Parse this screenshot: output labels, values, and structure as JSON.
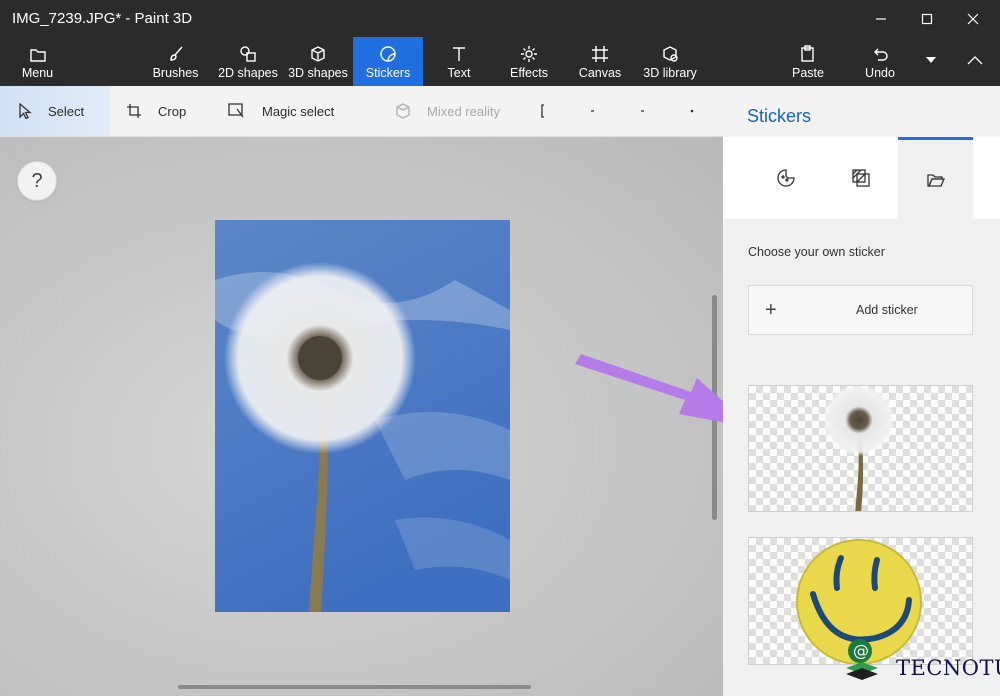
{
  "window": {
    "title": "IMG_7239.JPG* - Paint 3D",
    "controls": [
      "minimize",
      "maximize",
      "close"
    ]
  },
  "ribbon": {
    "menu_label": "Menu",
    "items": [
      {
        "label": "Brushes",
        "icon": "brush-icon"
      },
      {
        "label": "2D shapes",
        "icon": "2d-shapes-icon"
      },
      {
        "label": "3D shapes",
        "icon": "3d-shapes-icon"
      },
      {
        "label": "Stickers",
        "icon": "stickers-icon",
        "active": true
      },
      {
        "label": "Text",
        "icon": "text-icon"
      },
      {
        "label": "Effects",
        "icon": "effects-icon"
      },
      {
        "label": "Canvas",
        "icon": "canvas-icon"
      },
      {
        "label": "3D library",
        "icon": "3d-library-icon"
      }
    ],
    "paste_label": "Paste",
    "undo_label": "Undo",
    "accent": "#1f6fe0"
  },
  "toolbar": {
    "select_label": "Select",
    "crop_label": "Crop",
    "magic_select_label": "Magic select",
    "mixed_reality_label": "Mixed reality"
  },
  "canvas": {
    "help_label": "?"
  },
  "panel": {
    "title": "Stickers",
    "tabs": [
      {
        "icon": "emoji-sticker-icon"
      },
      {
        "icon": "texture-icon"
      },
      {
        "icon": "folder-open-icon",
        "active": true
      }
    ],
    "choose_text": "Choose your own sticker",
    "add_sticker_label": "Add sticker",
    "add_icon": "+"
  },
  "watermark": {
    "text": "TECNOTUTO",
    "symbol": "@"
  }
}
